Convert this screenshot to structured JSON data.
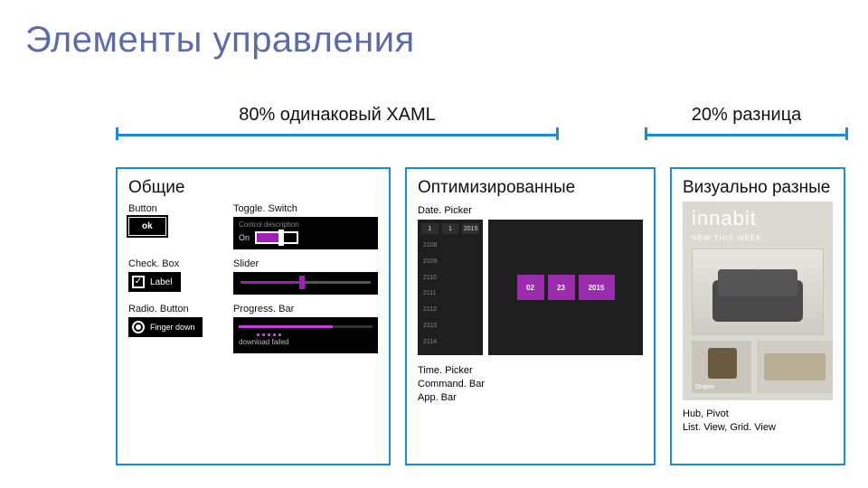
{
  "title": "Элементы управления",
  "brackets": {
    "same": "80% одинаковый XAML",
    "diff": "20% разница"
  },
  "columns": {
    "general": {
      "title": "Общие",
      "items": {
        "button": {
          "label": "Button",
          "demo_text": "ok"
        },
        "toggle": {
          "label": "Toggle. Switch",
          "desc": "Control description",
          "state": "On"
        },
        "checkbox": {
          "label": "Check. Box",
          "demo_text": "Label"
        },
        "slider": {
          "label": "Slider"
        },
        "radio": {
          "label": "Radio. Button",
          "demo_text": "Finger down"
        },
        "progress": {
          "label": "Progress. Bar",
          "fail_text": "download failed"
        }
      }
    },
    "optimized": {
      "title": "Оптимизированные",
      "datepicker_label": "Date. Picker",
      "phone_years": [
        "2108",
        "2109",
        "2110",
        "2111",
        "2112",
        "2113",
        "2114"
      ],
      "phone_sel": [
        "1",
        "1",
        "2015"
      ],
      "tablet_tiles": [
        "02",
        "23",
        "2015"
      ],
      "list": [
        "Time. Picker",
        "Command. Bar",
        "App. Bar"
      ]
    },
    "visual": {
      "title": "Визуально разные",
      "hub_title": "innabit",
      "hub_sub": "NEW THIS WEEK",
      "hub_small1": "Draper",
      "hub_small2": "",
      "list": "Hub, Pivot\nList. View, Grid. View"
    }
  }
}
